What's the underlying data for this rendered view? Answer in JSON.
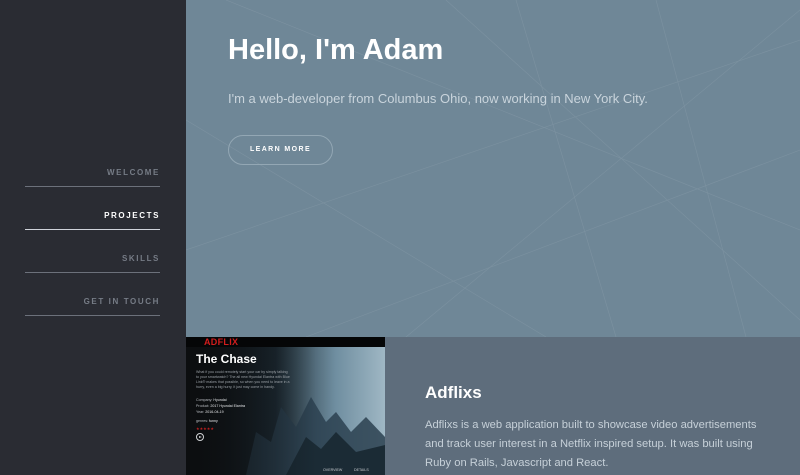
{
  "nav": {
    "items": [
      {
        "label": "WELCOME",
        "active": false
      },
      {
        "label": "PROJECTS",
        "active": true
      },
      {
        "label": "SKILLS",
        "active": false
      },
      {
        "label": "GET IN TOUCH",
        "active": false
      }
    ]
  },
  "hero": {
    "title": "Hello, I'm Adam",
    "subtitle": "I'm a web-developer from Columbus Ohio, now working in New York City.",
    "button_label": "LEARN MORE"
  },
  "project": {
    "title": "Adflixs",
    "description": "Adflixs is a web application built to showcase video advertisements and track user interest in a Netflix inspired setup. It was built using Ruby on Rails, Javascript and React.",
    "thumbnail": {
      "brand": "ADFLIX",
      "title": "The Chase",
      "description": "What if you could remotely start your car by simply talking to your smartwatch? The all new Hyundai Elantra with Blue Link® makes that possible, so when you need to leave in a hurry, even a big hurry, it just may come in handy.",
      "company_label": "Company:",
      "company_value": "Hyundai",
      "product_label": "Product:",
      "product_value": "2017 Hyundai Elantra",
      "year_label": "Year:",
      "year_value": "2016-04-19",
      "genre_label": "genres:",
      "genre_value": "funny",
      "stars": "★★★★★",
      "overview_label": "OVERVIEW",
      "details_label": "DETAILS"
    }
  },
  "colors": {
    "sidebar_bg": "#2a2c33",
    "hero_bg": "#6f8797",
    "project_bg": "#5e6d7c",
    "accent_red": "#d21d1d"
  }
}
